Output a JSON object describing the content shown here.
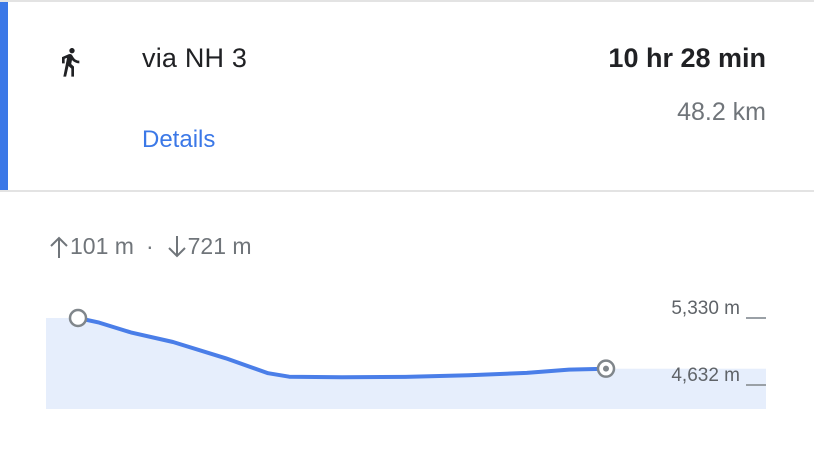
{
  "route": {
    "mode_icon": "walking-icon",
    "title": "via NH 3",
    "duration": "10 hr 28 min",
    "distance": "48.2 km",
    "details_label": "Details"
  },
  "elevation": {
    "ascent": "101 m",
    "descent": "721 m",
    "separator": "·",
    "ascent_icon": "arrow-up-icon",
    "descent_icon": "arrow-down-icon"
  },
  "chart_data": {
    "type": "area",
    "title": "",
    "xlabel": "",
    "ylabel": "",
    "x": [
      0,
      0.04,
      0.1,
      0.18,
      0.28,
      0.36,
      0.4,
      0.5,
      0.62,
      0.74,
      0.85,
      0.93,
      1.0
    ],
    "series": [
      {
        "values": [
          5330,
          5282,
          5180,
          5080,
          4910,
          4755,
          4718,
          4712,
          4716,
          4734,
          4758,
          4792,
          4802
        ]
      }
    ],
    "ylim": [
      4632,
      5330
    ],
    "tick_labels": [
      "5,330 m",
      "4,632 m"
    ],
    "start_marker": true,
    "end_marker": true,
    "grid": false,
    "colors": {
      "line": "#4a7ee8",
      "fill": "#e6eefc",
      "marker_stroke": "#80868b",
      "tick": "#9aa0a6"
    }
  }
}
